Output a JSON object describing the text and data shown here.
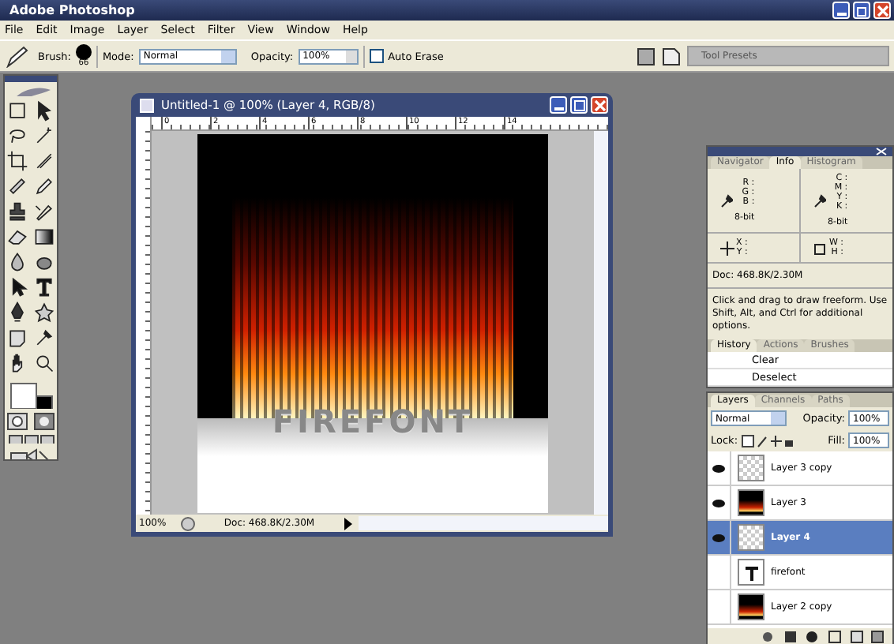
{
  "app": {
    "title": "Adobe Photoshop"
  },
  "menu": [
    "File",
    "Edit",
    "Image",
    "Layer",
    "Select",
    "Filter",
    "View",
    "Window",
    "Help"
  ],
  "options_bar": {
    "brush_label": "Brush:",
    "brush_size": "66",
    "mode_label": "Mode:",
    "mode": "Normal",
    "opacity_label": "Opacity:",
    "opacity": "100%",
    "auto_erase": {
      "label": "Auto Erase",
      "checked": false
    },
    "tool_presets": "Tool Presets"
  },
  "document": {
    "title": "Untitled-1 @ 100% (Layer 4, RGB/8)",
    "ruler_ticks": [
      "0",
      "2",
      "4",
      "6",
      "8",
      "10",
      "12",
      "14"
    ],
    "canvas_text": "FIREFONT",
    "zoom": "100%",
    "doc_size": "Doc: 468.8K/2.30M"
  },
  "info_panel": {
    "tabs": [
      {
        "label": "Navigator",
        "selected": false
      },
      {
        "label": "Info",
        "selected": true
      },
      {
        "label": "Histogram",
        "selected": false
      }
    ],
    "rgb": [
      "R :",
      "G :",
      "B :"
    ],
    "cmyk": [
      "C :",
      "M :",
      "Y :",
      "K :"
    ],
    "bit_left": "8-bit",
    "bit_right": "8-bit",
    "xy": [
      "X :",
      "Y :"
    ],
    "wh": [
      "W :",
      "H :"
    ],
    "doc_size": "Doc: 468.8K/2.30M",
    "hint": "Click and drag to draw freeform.  Use Shift, Alt, and Ctrl for additional options."
  },
  "history_panel": {
    "tabs": [
      {
        "label": "History",
        "selected": true
      },
      {
        "label": "Actions",
        "selected": false
      },
      {
        "label": "Brushes",
        "selected": false
      }
    ],
    "items": [
      "Clear",
      "Deselect"
    ]
  },
  "layers_panel": {
    "tabs": [
      {
        "label": "Layers",
        "selected": true
      },
      {
        "label": "Channels",
        "selected": false
      },
      {
        "label": "Paths",
        "selected": false
      }
    ],
    "mode": "Normal",
    "opacity_label": "Opacity:",
    "opacity": "100%",
    "lock_label": "Lock:",
    "fill_label": "Fill:",
    "fill": "100%",
    "layers": [
      {
        "name": "Layer 3 copy",
        "visible": true,
        "selected": false,
        "kind": "transparent"
      },
      {
        "name": "Layer 3",
        "visible": true,
        "selected": false,
        "kind": "fire"
      },
      {
        "name": "Layer 4",
        "visible": true,
        "selected": true,
        "kind": "transparent"
      },
      {
        "name": "firefont",
        "visible": false,
        "selected": false,
        "kind": "text"
      },
      {
        "name": "Layer 2 copy",
        "visible": false,
        "selected": false,
        "kind": "fire"
      }
    ]
  }
}
